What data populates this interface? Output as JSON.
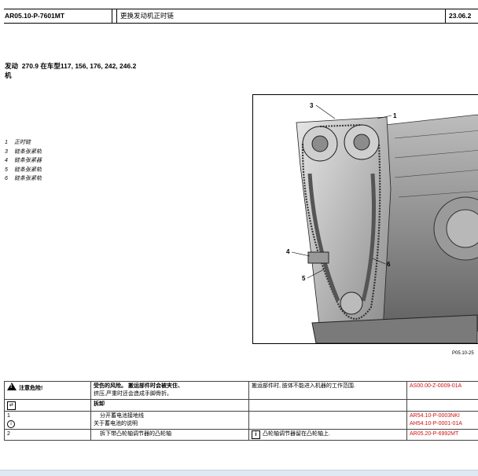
{
  "header": {
    "doc_id": "AR05.10-P-7601MT",
    "title": "更换发动机正时链",
    "date": "23.06.2"
  },
  "engine": {
    "label_line1": "发动",
    "label_line2": "机",
    "text": "270.9 在车型117, 156, 176, 242, 246.2"
  },
  "legend": [
    {
      "num": "1",
      "text": "正时链"
    },
    {
      "num": "3",
      "text": "链条张紧轨"
    },
    {
      "num": "4",
      "text": "链条张紧器"
    },
    {
      "num": "5",
      "text": "链条张紧轨"
    },
    {
      "num": "6",
      "text": "链条张紧轨"
    }
  ],
  "figure": {
    "id": "P05.10-25",
    "callouts": [
      "3",
      "1",
      "4",
      "5",
      "6"
    ]
  },
  "table": {
    "warning": {
      "label": "注意危险!",
      "risk_line1": "受伤的风险。 搬运部件时会被夹住、",
      "risk_line2": "挤压,严重时还会造成手脚骨折。",
      "measure": "搬运部件时, 肢体不能进入机器的工作范围.",
      "ref": "AS00.00-Z-0009-01A"
    },
    "section": {
      "label": "拆卸"
    },
    "step1": {
      "num": "1",
      "text": "分开蓄电池接地线",
      "note": "关于蓄电池的说明",
      "ref1": "AR54.10-P-0003NKI",
      "ref2": "AH54.10-P-0001-01A"
    },
    "step2": {
      "num": "2",
      "text": "拆下带凸轮轴调节器的凸轮轴",
      "info": "凸轮轴调节器留在凸轮轴上.",
      "ref": "AR05.20-P-6992MT"
    }
  }
}
